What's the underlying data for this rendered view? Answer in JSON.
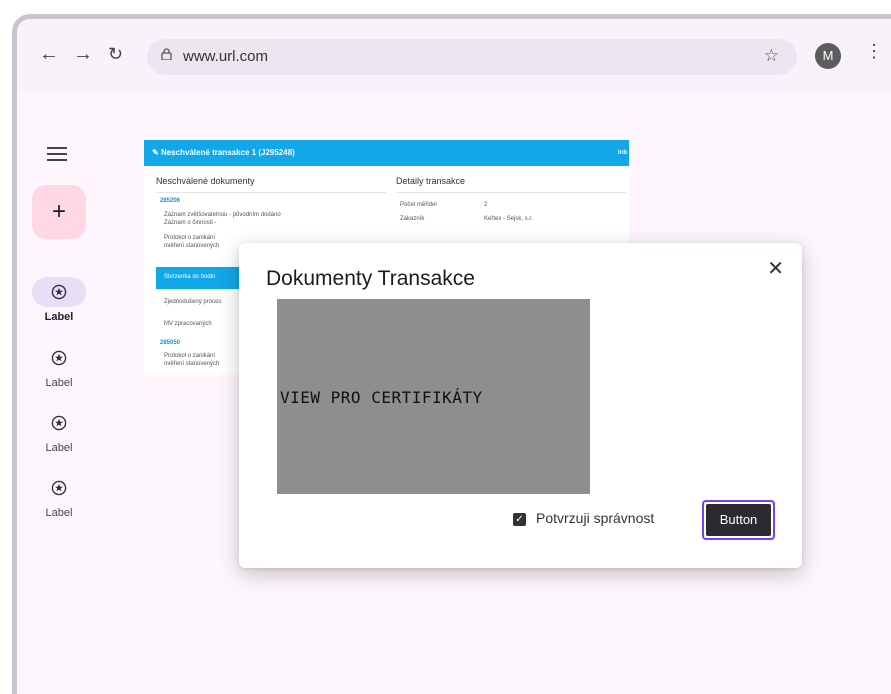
{
  "browser": {
    "url": "www.url.com",
    "avatar_letter": "M"
  },
  "rail": {
    "items": [
      {
        "label": "Label",
        "active": true
      },
      {
        "label": "Label",
        "active": false
      },
      {
        "label": "Label",
        "active": false
      },
      {
        "label": "Label",
        "active": false
      }
    ]
  },
  "background_app": {
    "header": "Neschválené transakce 1 (J295248)",
    "header_right": "Inb",
    "left_title": "Neschválené dokumenty",
    "right_title": "Detaily transakce",
    "rows": [
      "285206",
      "Záznam zvětšovatelnou - původním dodáno",
      "Záznam o činnosti -",
      "Protokol o zanikání",
      "ověření stanovených",
      "Stvrzenka do hodin",
      "Zjednodušený proces",
      "MV zpracovaných",
      "285050",
      "Protokol o zanikání",
      "ověření stanovených"
    ],
    "right_rows": [
      {
        "k": "Počet měřidel",
        "v": "2"
      },
      {
        "k": "Zákazník",
        "v": "Keřtex - Sejsk, s.r."
      }
    ]
  },
  "dialog": {
    "title": "Dokumenty Transakce",
    "viewer_text": "VIEW PRO CERTIFIKÁTY",
    "checkbox_label": "Potvrzuji správnost",
    "checkbox_checked": true,
    "button_label": "Button"
  }
}
